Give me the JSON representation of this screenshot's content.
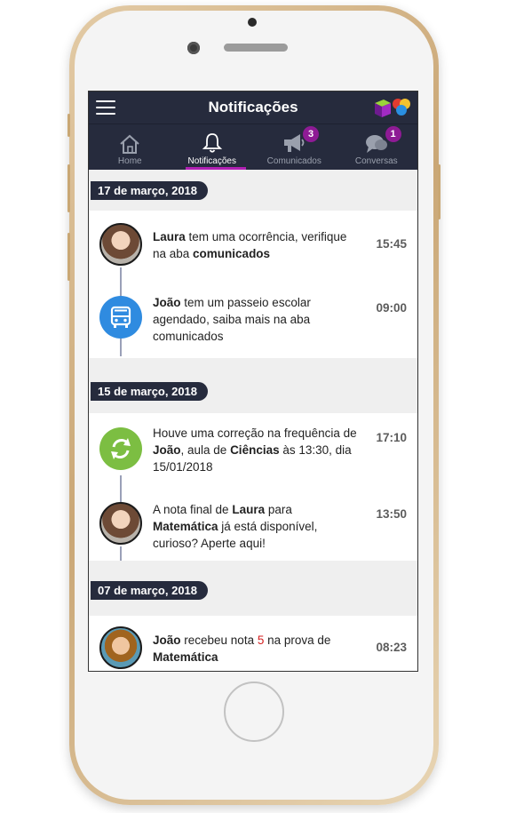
{
  "app": {
    "title": "Notificações"
  },
  "tabs": [
    {
      "label": "Home",
      "icon": "home-icon",
      "badge": null,
      "active": false
    },
    {
      "label": "Notificações",
      "icon": "bell-icon",
      "badge": null,
      "active": true
    },
    {
      "label": "Comunicados",
      "icon": "megaphone-icon",
      "badge": "3",
      "active": false
    },
    {
      "label": "Conversas",
      "icon": "chat-icon",
      "badge": "1",
      "active": false
    }
  ],
  "colors": {
    "header": "#262b3d",
    "accent": "#b120b4",
    "badge": "#8e1b95",
    "bus": "#2f8be0",
    "sync": "#7cbe42",
    "highlight_red": "#d41f1f"
  },
  "groups": [
    {
      "date": "17 de março, 2018",
      "items": [
        {
          "icon": "avatar-laura",
          "time": "15:45",
          "parts": [
            {
              "t": "Laura",
              "b": true
            },
            {
              "t": " tem uma ocorrência, verifique na aba ",
              "b": false
            },
            {
              "t": "comunicados",
              "b": true
            }
          ]
        },
        {
          "icon": "bus-icon",
          "time": "09:00",
          "parts": [
            {
              "t": "João",
              "b": true
            },
            {
              "t": " tem um passeio escolar agendado, saiba mais na aba comunicados",
              "b": false
            }
          ]
        }
      ]
    },
    {
      "date": "15 de março, 2018",
      "items": [
        {
          "icon": "sync-icon",
          "time": "17:10",
          "parts": [
            {
              "t": "Houve uma correção na frequência de ",
              "b": false
            },
            {
              "t": "João",
              "b": true
            },
            {
              "t": ", aula de ",
              "b": false
            },
            {
              "t": "Ciências",
              "b": true
            },
            {
              "t": " às 13:30, dia 15/01/2018",
              "b": false
            }
          ]
        },
        {
          "icon": "avatar-laura",
          "time": "13:50",
          "parts": [
            {
              "t": "A nota final de ",
              "b": false
            },
            {
              "t": "Laura",
              "b": true
            },
            {
              "t": " para ",
              "b": false
            },
            {
              "t": "Matemática",
              "b": true
            },
            {
              "t": " já está disponível, curioso? Aperte aqui!",
              "b": false
            }
          ]
        }
      ]
    },
    {
      "date": "07 de março, 2018",
      "items": [
        {
          "icon": "avatar-joao",
          "time": "08:23",
          "parts": [
            {
              "t": "João",
              "b": true
            },
            {
              "t": " recebeu nota ",
              "b": false
            },
            {
              "t": "5",
              "b": false,
              "red": true
            },
            {
              "t": " na prova de ",
              "b": false
            },
            {
              "t": "Matemática",
              "b": true
            }
          ]
        }
      ]
    }
  ]
}
